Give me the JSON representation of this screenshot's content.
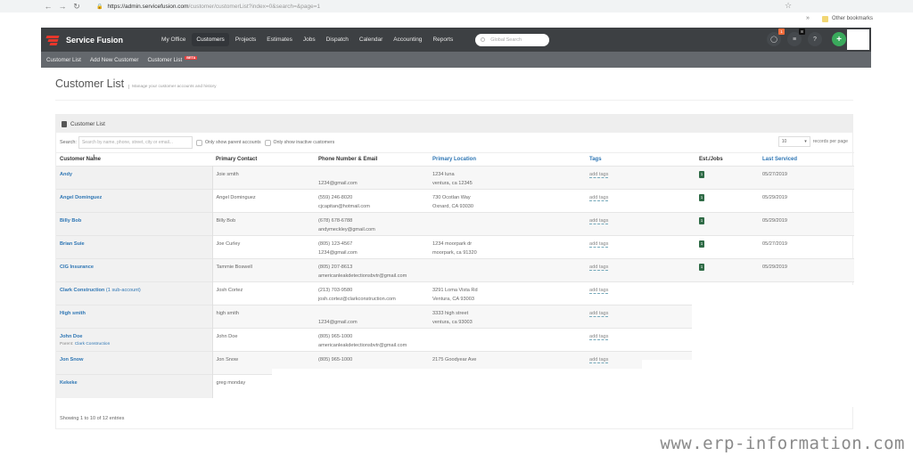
{
  "browser": {
    "url_host": "https://admin.servicefusion.com",
    "url_path": "/customer/customerList?index=0&search=&page=1",
    "bookmarks_label": "Other bookmarks"
  },
  "header": {
    "brand": "Service Fusion",
    "nav": [
      "My Office",
      "Customers",
      "Projects",
      "Estimates",
      "Jobs",
      "Dispatch",
      "Calendar",
      "Accounting",
      "Reports"
    ],
    "active_nav": "Customers",
    "global_search_placeholder": "Global Search",
    "chat_badge": "1",
    "tasks_badge": "8",
    "help_label": "?",
    "add_label": "+"
  },
  "subnav": {
    "items": [
      "Customer List",
      "Add New Customer",
      "Customer List"
    ],
    "beta_label": "BETA"
  },
  "page": {
    "title": "Customer List",
    "subtitle": "Manage your customer accounts and history"
  },
  "panel": {
    "title": "Customer List",
    "search_label": "Search:",
    "search_placeholder": "Search by name, phone, street, city or email...",
    "filter_parent": "Only show parent accounts",
    "filter_inactive": "Only show inactive customers",
    "per_page_value": "10",
    "per_page_label": "records per page",
    "footer": "Showing 1 to 10 of 12 entries"
  },
  "table": {
    "columns": [
      "Customer Name",
      "Primary Contact",
      "Phone Number & Email",
      "Primary Location",
      "Tags",
      "Est./Jobs",
      "Last Serviced"
    ],
    "rows": [
      {
        "name": "Andy",
        "sub": "",
        "parent": "",
        "contact": "Joie smith",
        "phone": "",
        "email": "1234@gmail.com",
        "addr1": "1234 luna",
        "addr2": "ventura, ca 12345",
        "tags": "add tags",
        "jobs": "1",
        "last": "05/27/2019"
      },
      {
        "name": "Angel Dominguez",
        "sub": "",
        "parent": "",
        "contact": "Angel Dominguez",
        "phone": "(559) 246-8020",
        "email": "cjcapitan@hotmail.com",
        "addr1": "730 Ocotlan Way",
        "addr2": "Oxnard, CA 93030",
        "tags": "add tags",
        "jobs": "1",
        "last": "05/29/2019"
      },
      {
        "name": "Billy Bob",
        "sub": "",
        "parent": "",
        "contact": "Billy Bob",
        "phone": "(678) 678-6788",
        "email": "andymeckley@gmail.com",
        "addr1": "",
        "addr2": "",
        "tags": "add tags",
        "jobs": "1",
        "last": "05/29/2019"
      },
      {
        "name": "Brian Suie",
        "sub": "",
        "parent": "",
        "contact": "Joe Curley",
        "phone": "(805) 123-4567",
        "email": "1234@gmail.com",
        "addr1": "1234 moorpark dr",
        "addr2": "moorpark, ca 91320",
        "tags": "add tags",
        "jobs": "1",
        "last": "05/27/2019"
      },
      {
        "name": "CIG Insurance",
        "sub": "",
        "parent": "",
        "contact": "Tammie Boswell",
        "phone": "(805) 207-8613",
        "email": "americanleakdetectionsbvtr@gmail.com",
        "addr1": "",
        "addr2": "",
        "tags": "add tags",
        "jobs": "1",
        "last": "05/29/2019"
      },
      {
        "name": "Clark Construction",
        "sub": "(1 sub-account)",
        "parent": "",
        "contact": "Josh Cortez",
        "phone": "(213) 703-9580",
        "email": "josh.cortez@clarkconstruction.com",
        "addr1": "3291 Loma Vista Rd",
        "addr2": "Ventura, CA 93003",
        "tags": "add tags",
        "jobs": "",
        "last": ""
      },
      {
        "name": "High smith",
        "sub": "",
        "parent": "",
        "contact": "high smith",
        "phone": "",
        "email": "1234@gmail.com",
        "addr1": "3333 high street",
        "addr2": "ventura, ca 93003",
        "tags": "add tags",
        "jobs": "",
        "last": ""
      },
      {
        "name": "John Doe",
        "sub": "",
        "parent": "Clark Construction",
        "contact": "John Doe",
        "phone": "(805) 965-1000",
        "email": "americanleakdetectionsbvtr@gmail.com",
        "addr1": "",
        "addr2": "",
        "tags": "add tags",
        "jobs": "",
        "last": ""
      },
      {
        "name": "Jon Snow",
        "sub": "",
        "parent": "",
        "contact": "Jon Snow",
        "phone": "(805) 965-1000",
        "email": "",
        "addr1": "2175 Goodyear Ave",
        "addr2": "",
        "tags": "add tags",
        "jobs": "",
        "last": ""
      },
      {
        "name": "Kekeke",
        "sub": "",
        "parent": "",
        "contact": "greg monday",
        "phone": "",
        "email": "",
        "addr1": "",
        "addr2": "",
        "tags": "",
        "jobs": "",
        "last": ""
      }
    ],
    "parent_prefix": "Parent: "
  },
  "watermark": "www.erp-information.com",
  "colors": {
    "header_bg": "#3d4043",
    "subnav_bg": "#64686d",
    "link_blue": "#2e76b4",
    "badge_green": "#2f6b46",
    "add_green": "#3aaa5c",
    "brand_red": "#e8372b"
  }
}
